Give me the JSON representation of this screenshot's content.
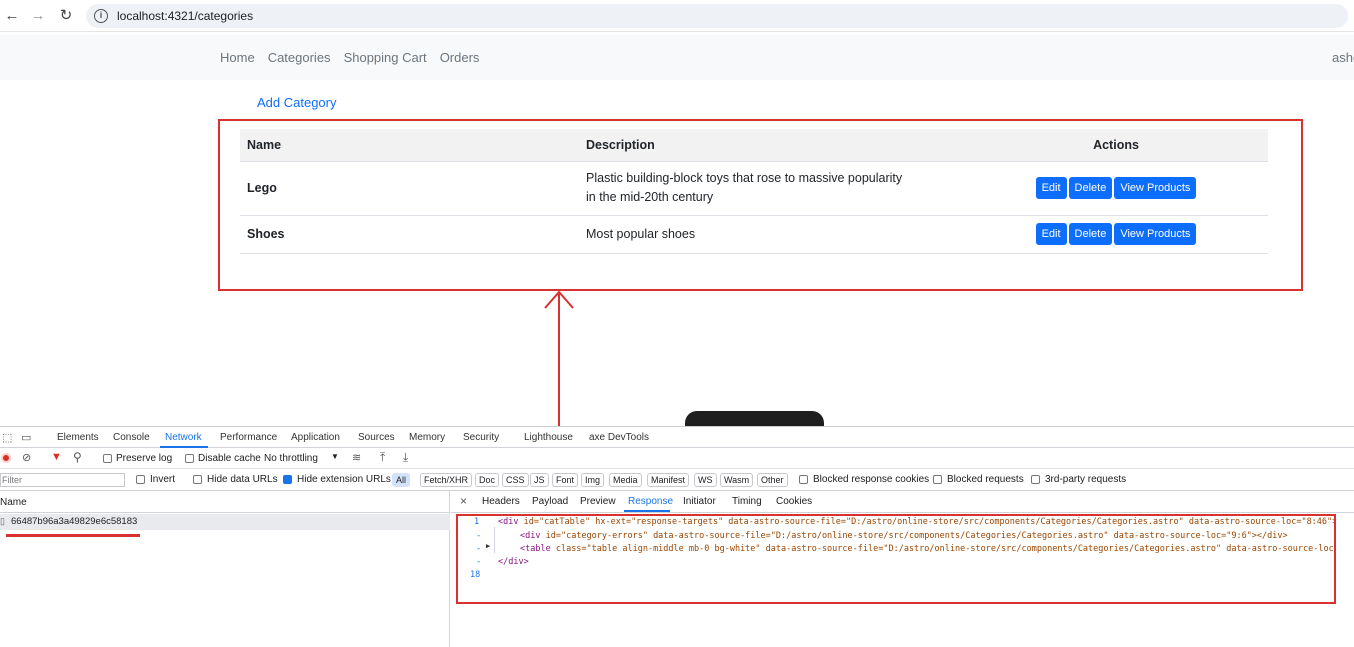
{
  "browser": {
    "url": "localhost:4321/categories",
    "back_icon": "←",
    "forward_icon": "→",
    "reload_icon": "↻"
  },
  "app_nav": {
    "links": [
      "Home",
      "Categories",
      "Shopping Cart",
      "Orders"
    ],
    "user": "asho"
  },
  "page": {
    "add_category": "Add Category",
    "table": {
      "headers": [
        "Name",
        "Description",
        "Actions"
      ],
      "rows": [
        {
          "name": "Lego",
          "description_line1": "Plastic building-block toys that rose to massive popularity",
          "description_line2": "in the mid-20th century"
        },
        {
          "name": "Shoes",
          "description_line1": "Most popular shoes",
          "description_line2": ""
        }
      ],
      "buttons": {
        "edit": "Edit",
        "delete": "Delete",
        "view": "View Products"
      }
    }
  },
  "devtools": {
    "tabs": [
      "Elements",
      "Console",
      "Network",
      "Performance",
      "Application",
      "Sources",
      "Memory",
      "Security",
      "Lighthouse",
      "axe DevTools"
    ],
    "active_tab": "Network",
    "toolbar": {
      "preserve_log": "Preserve log",
      "disable_cache": "Disable cache",
      "throttling": "No throttling"
    },
    "filter": {
      "placeholder": "Filter",
      "invert": "Invert",
      "hide_data_urls": "Hide data URLs",
      "hide_extension_urls": "Hide extension URLs",
      "chips": [
        "All",
        "Fetch/XHR",
        "Doc",
        "CSS",
        "JS",
        "Font",
        "Img",
        "Media",
        "Manifest",
        "WS",
        "Wasm",
        "Other"
      ],
      "blocked_response_cookies": "Blocked response cookies",
      "blocked_requests": "Blocked requests",
      "third_party": "3rd-party requests"
    },
    "requests": {
      "column_name": "Name",
      "items": [
        "66487b96a3a49829e6c58183"
      ]
    },
    "detail_tabs": [
      "Headers",
      "Payload",
      "Preview",
      "Response",
      "Initiator",
      "Timing",
      "Cookies"
    ],
    "active_detail_tab": "Response",
    "response": {
      "line_numbers": [
        "1",
        "-",
        "-",
        "-",
        "18"
      ],
      "line1_tag": "<div",
      "line1_attrs": " id=\"catTable\" hx-ext=\"response-targets\" data-astro-source-file=\"D:/astro/online-store/src/components/Categories/Categories.astro\" data-astro-source-loc=\"8:46\">",
      "line2_tag": "<div",
      "line2_attrs": " id=\"category-errors\" data-astro-source-file=\"D:/astro/online-store/src/components/Categories/Categories.astro\" data-astro-source-loc=\"9:6\"></div>",
      "line3_tag": "<table",
      "line3_attrs": " class=\"table align-middle mb-0 bg-white\" data-astro-source-file=\"D:/astro/online-store/src/components/Categories/Categories.astro\" data-astro-source-loc=",
      "line4": "</div>"
    }
  },
  "colors": {
    "annotation_red": "#d93030",
    "bootstrap_primary": "#0d6efd",
    "devtools_blue": "#1a73e8"
  }
}
